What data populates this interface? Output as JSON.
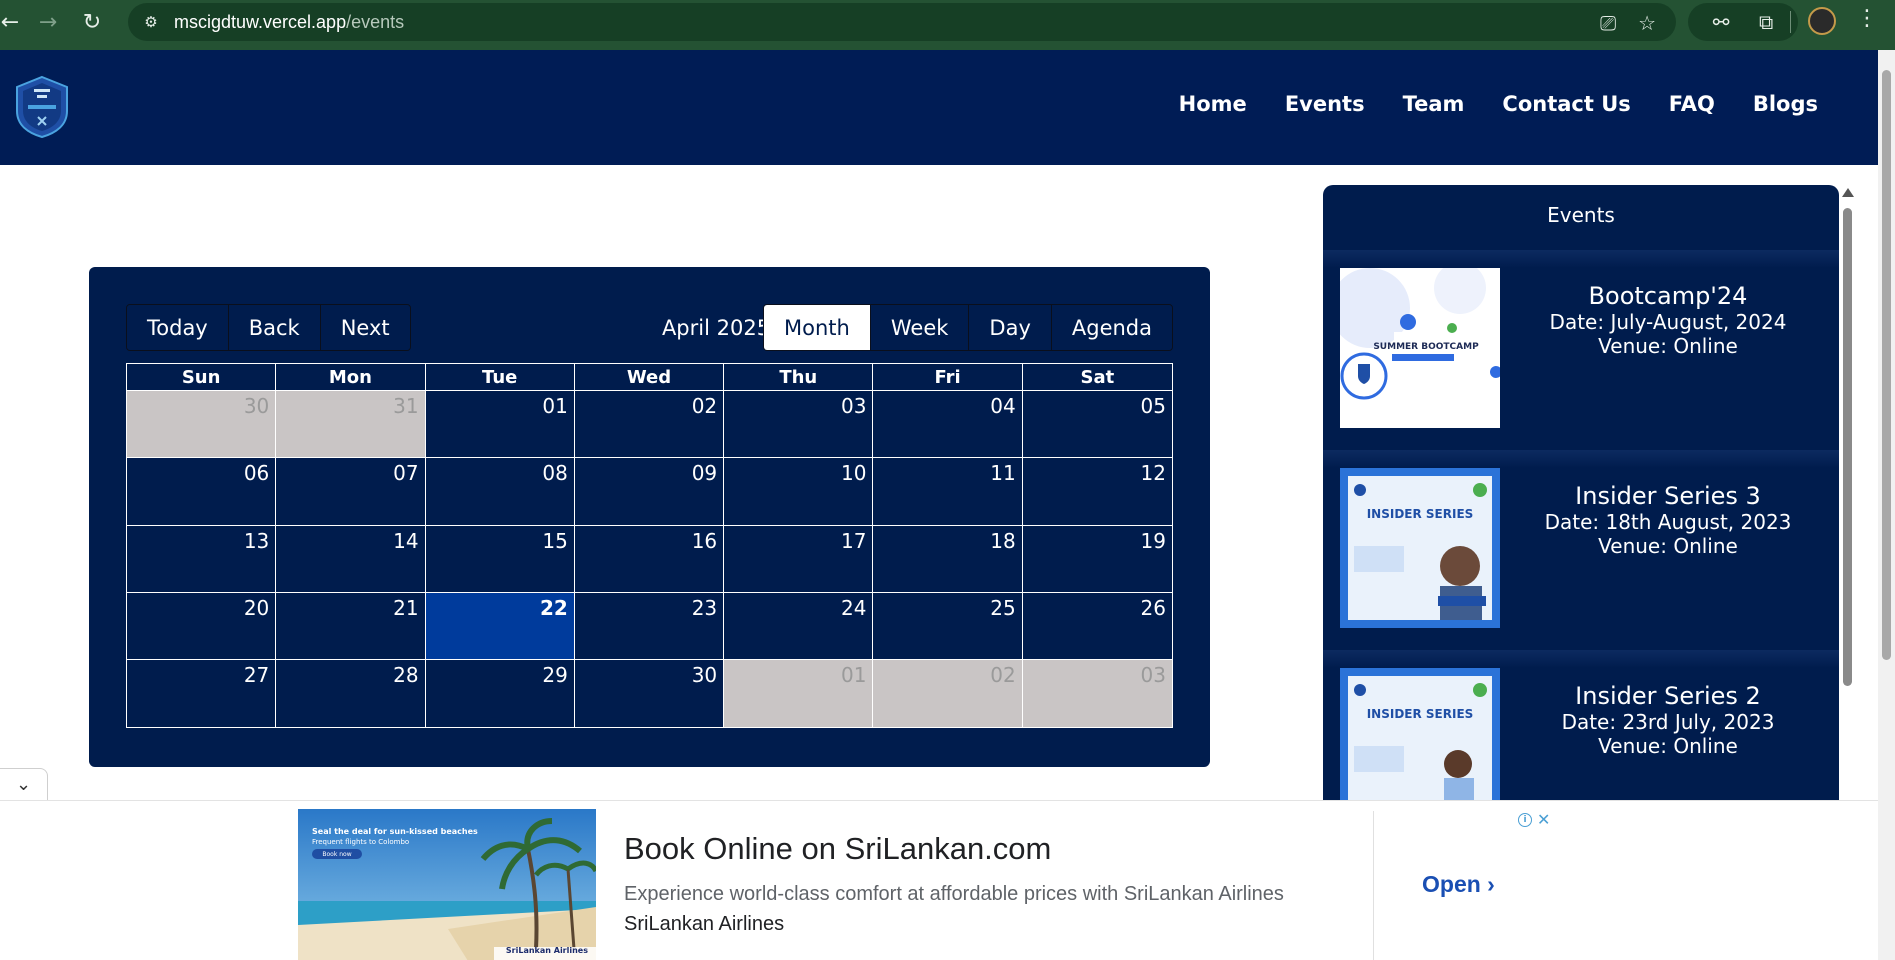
{
  "browser": {
    "url_domain": "mscigdtuw.vercel.app",
    "url_path": "/events"
  },
  "site": {
    "nav": [
      "Home",
      "Events",
      "Team",
      "Contact Us",
      "FAQ",
      "Blogs"
    ]
  },
  "calendar": {
    "nav_buttons": [
      "Today",
      "Back",
      "Next"
    ],
    "label": "April 2025",
    "views": [
      "Month",
      "Week",
      "Day",
      "Agenda"
    ],
    "active_view": "Month",
    "weekdays": [
      "Sun",
      "Mon",
      "Tue",
      "Wed",
      "Thu",
      "Fri",
      "Sat"
    ],
    "weeks": [
      [
        "30",
        "31",
        "01",
        "02",
        "03",
        "04",
        "05"
      ],
      [
        "06",
        "07",
        "08",
        "09",
        "10",
        "11",
        "12"
      ],
      [
        "13",
        "14",
        "15",
        "16",
        "17",
        "18",
        "19"
      ],
      [
        "20",
        "21",
        "22",
        "23",
        "24",
        "25",
        "26"
      ],
      [
        "27",
        "28",
        "29",
        "30",
        "01",
        "02",
        "03"
      ]
    ],
    "today": "22"
  },
  "events": {
    "title": "Events",
    "items": [
      {
        "name": "Bootcamp'24",
        "date": "Date: July-August, 2024",
        "venue": "Venue: Online",
        "thumb_text": "SUMMER BOOTCAMP"
      },
      {
        "name": "Insider Series 3",
        "date": "Date: 18th August, 2023",
        "venue": "Venue: Online",
        "thumb_text": "INSIDER SERIES"
      },
      {
        "name": "Insider Series 2",
        "date": "Date: 23rd July, 2023",
        "venue": "Venue: Online",
        "thumb_text": "INSIDER SERIES"
      }
    ]
  },
  "ad": {
    "image_line1": "Seal the deal for sun-kissed beaches",
    "image_line2": "Frequent flights to Colombo",
    "image_button": "Book now",
    "image_brand": "SriLankan Airlines",
    "headline": "Book Online on SriLankan.com",
    "description": "Experience world-class comfort at affordable prices with SriLankan Airlines",
    "advertiser": "SriLankan Airlines",
    "cta": "Open"
  }
}
